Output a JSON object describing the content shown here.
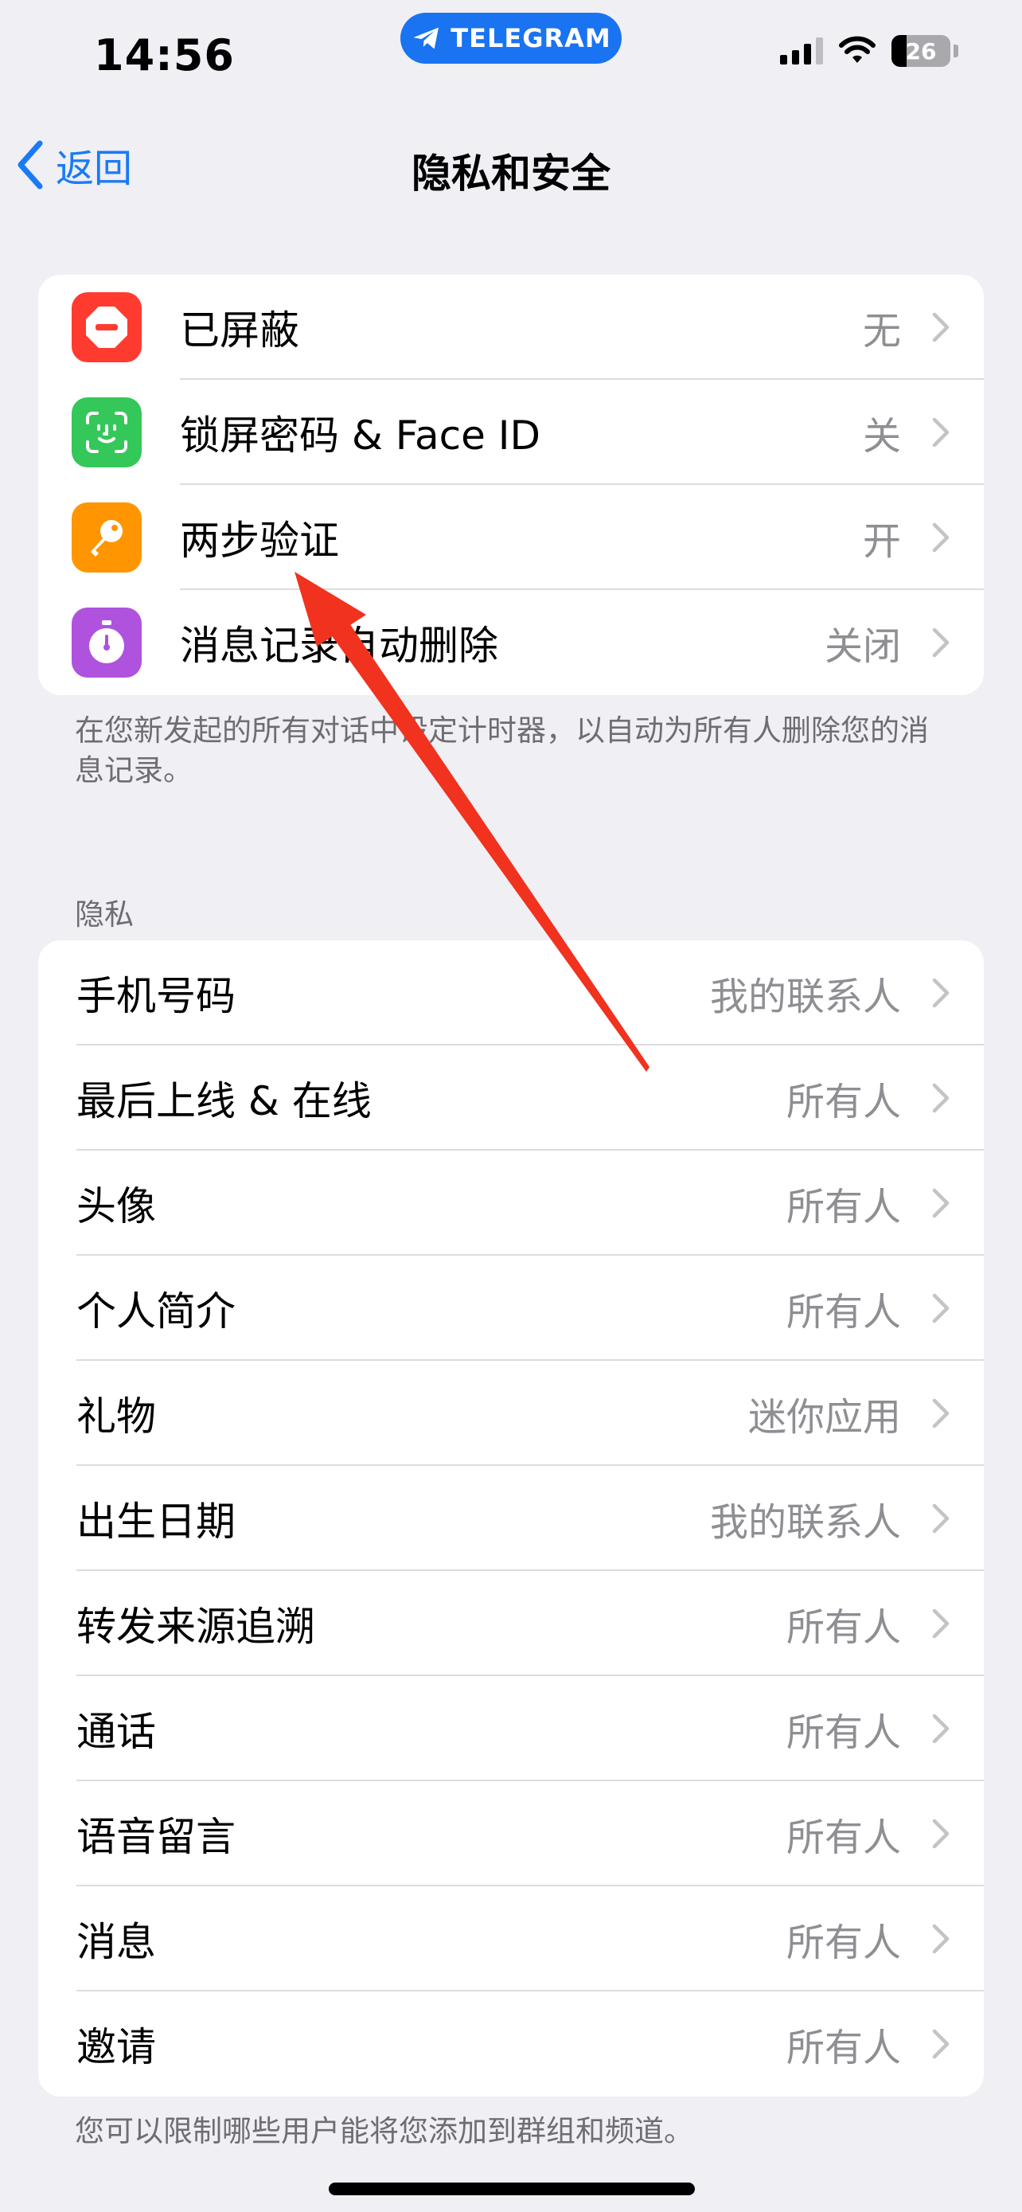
{
  "status_bar": {
    "time": "14:56",
    "app_pill": "TELEGRAM",
    "battery": "26",
    "icons": [
      "signal-icon",
      "wifi-icon",
      "battery-icon"
    ]
  },
  "nav": {
    "back_label": "返回",
    "title": "隐私和安全"
  },
  "security": {
    "items": [
      {
        "label": "已屏蔽",
        "value": "无",
        "icon": "blocked-icon",
        "color": "#ff3b30"
      },
      {
        "label": "锁屏密码 & Face ID",
        "value": "关",
        "icon": "face-id-icon",
        "color": "#34c759"
      },
      {
        "label": "两步验证",
        "value": "开",
        "icon": "key-icon",
        "color": "#ff9500"
      },
      {
        "label": "消息记录自动删除",
        "value": "关闭",
        "icon": "timer-icon",
        "color": "#af52de"
      }
    ],
    "footnote": "在您新发起的所有对话中设定计时器，以自动为所有人删除您的消息记录。"
  },
  "privacy": {
    "header": "隐私",
    "items": [
      {
        "label": "手机号码",
        "value": "我的联系人"
      },
      {
        "label": "最后上线 & 在线",
        "value": "所有人"
      },
      {
        "label": "头像",
        "value": "所有人"
      },
      {
        "label": "个人简介",
        "value": "所有人"
      },
      {
        "label": "礼物",
        "value": "迷你应用"
      },
      {
        "label": "出生日期",
        "value": "我的联系人"
      },
      {
        "label": "转发来源追溯",
        "value": "所有人"
      },
      {
        "label": "通话",
        "value": "所有人"
      },
      {
        "label": "语音留言",
        "value": "所有人"
      },
      {
        "label": "消息",
        "value": "所有人"
      },
      {
        "label": "邀请",
        "value": "所有人"
      }
    ],
    "footnote": "您可以限制哪些用户能将您添加到群组和频道。"
  },
  "colors": {
    "accent": "#1a7af5",
    "background": "#efeff4",
    "annotation_arrow": "#f0321e"
  }
}
